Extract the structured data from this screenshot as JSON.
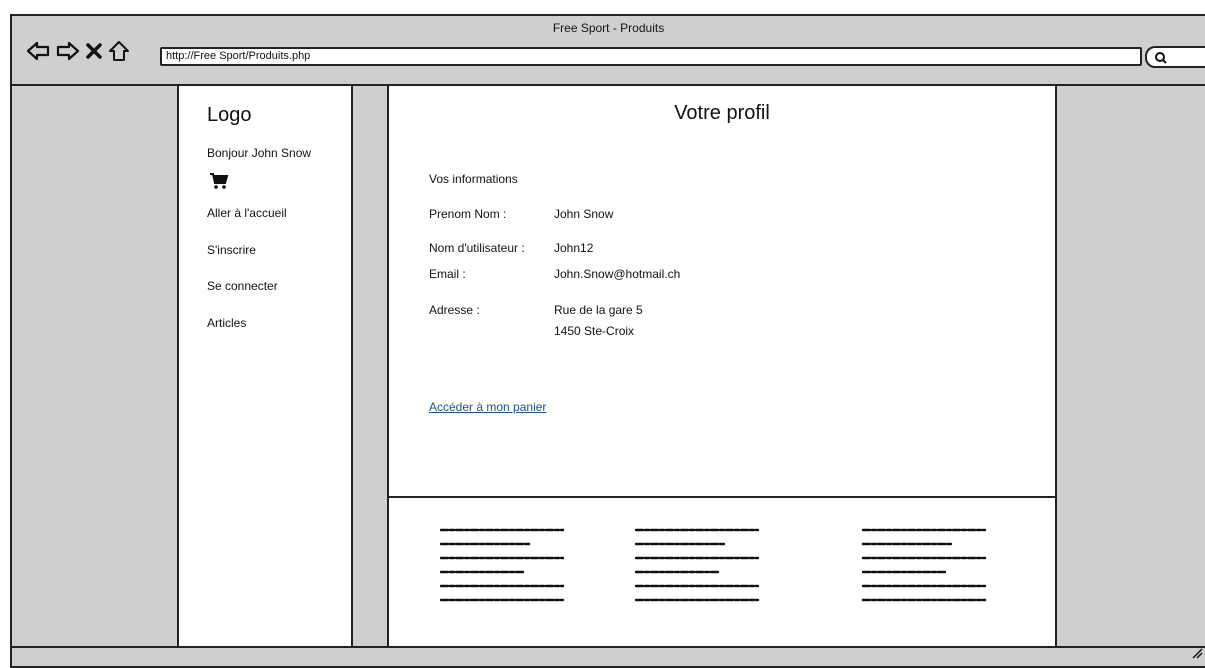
{
  "window": {
    "title": "Free Sport - Produits"
  },
  "browser": {
    "url": "http://Free Sport/Produits.php",
    "icons": [
      "back-arrow-icon",
      "forward-arrow-icon",
      "close-icon",
      "home-icon",
      "search-icon"
    ]
  },
  "sidebar": {
    "logo": "Logo",
    "greeting": "Bonjour John Snow",
    "cart_icon": "cart-icon",
    "links": [
      "Aller à l'accueil",
      "S'inscrire",
      "Se connecter",
      "Articles"
    ]
  },
  "profile": {
    "title": "Votre profil",
    "section_title": "Vos informations",
    "fields": [
      {
        "label": "Prenom Nom :",
        "value": "John Snow"
      },
      {
        "label": "Nom d'utilisateur :",
        "value": "John12"
      },
      {
        "label": "Email :",
        "value": "John.Snow@hotmail.ch"
      },
      {
        "label": "Adresse :",
        "value": "Rue de la gare 5"
      }
    ],
    "address_line2": "1450 Ste-Croix",
    "basket_link": "Accéder à mon panier"
  },
  "colors": {
    "link": "#1d4f91",
    "chrome": "#cfcfcf",
    "border": "#222222"
  }
}
